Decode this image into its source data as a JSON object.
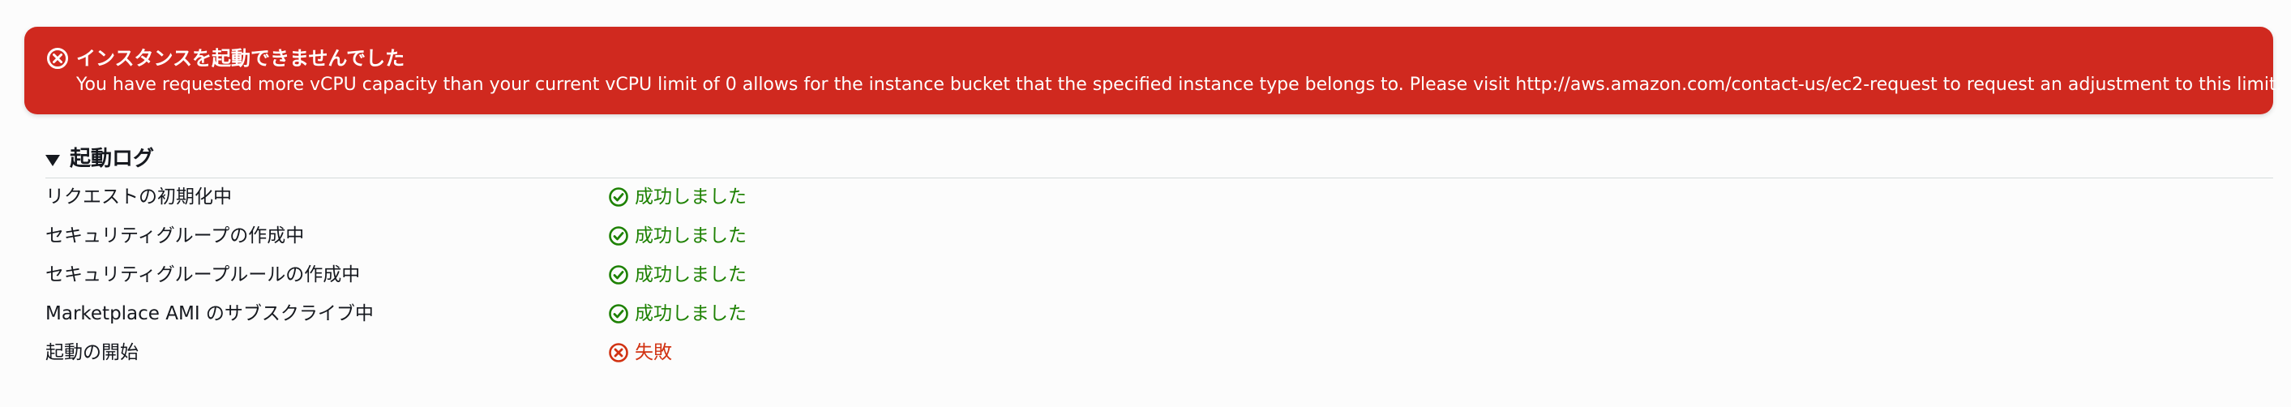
{
  "colors": {
    "banner_bg": "#d0291f",
    "success": "#1d8102",
    "error": "#d13212",
    "text": "#16191f"
  },
  "error_banner": {
    "icon": "error-x-circle-icon",
    "title": "インスタンスを起動できませんでした",
    "message": "You have requested more vCPU capacity than your current vCPU limit of 0 allows for the instance bucket that the specified instance type belongs to. Please visit http://aws.amazon.com/contact-us/ec2-request to request an adjustment to this limit."
  },
  "launch_log": {
    "title": "起動ログ",
    "expanded": true,
    "items": [
      {
        "label": "リクエストの初期化中",
        "status": "成功しました",
        "state": "success",
        "icon": "check-circle-icon"
      },
      {
        "label": "セキュリティグループの作成中",
        "status": "成功しました",
        "state": "success",
        "icon": "check-circle-icon"
      },
      {
        "label": "セキュリティグループルールの作成中",
        "status": "成功しました",
        "state": "success",
        "icon": "check-circle-icon"
      },
      {
        "label": "Marketplace AMI のサブスクライブ中",
        "status": "成功しました",
        "state": "success",
        "icon": "check-circle-icon"
      },
      {
        "label": "起動の開始",
        "status": "失敗",
        "state": "failure",
        "icon": "error-x-circle-icon"
      }
    ]
  }
}
